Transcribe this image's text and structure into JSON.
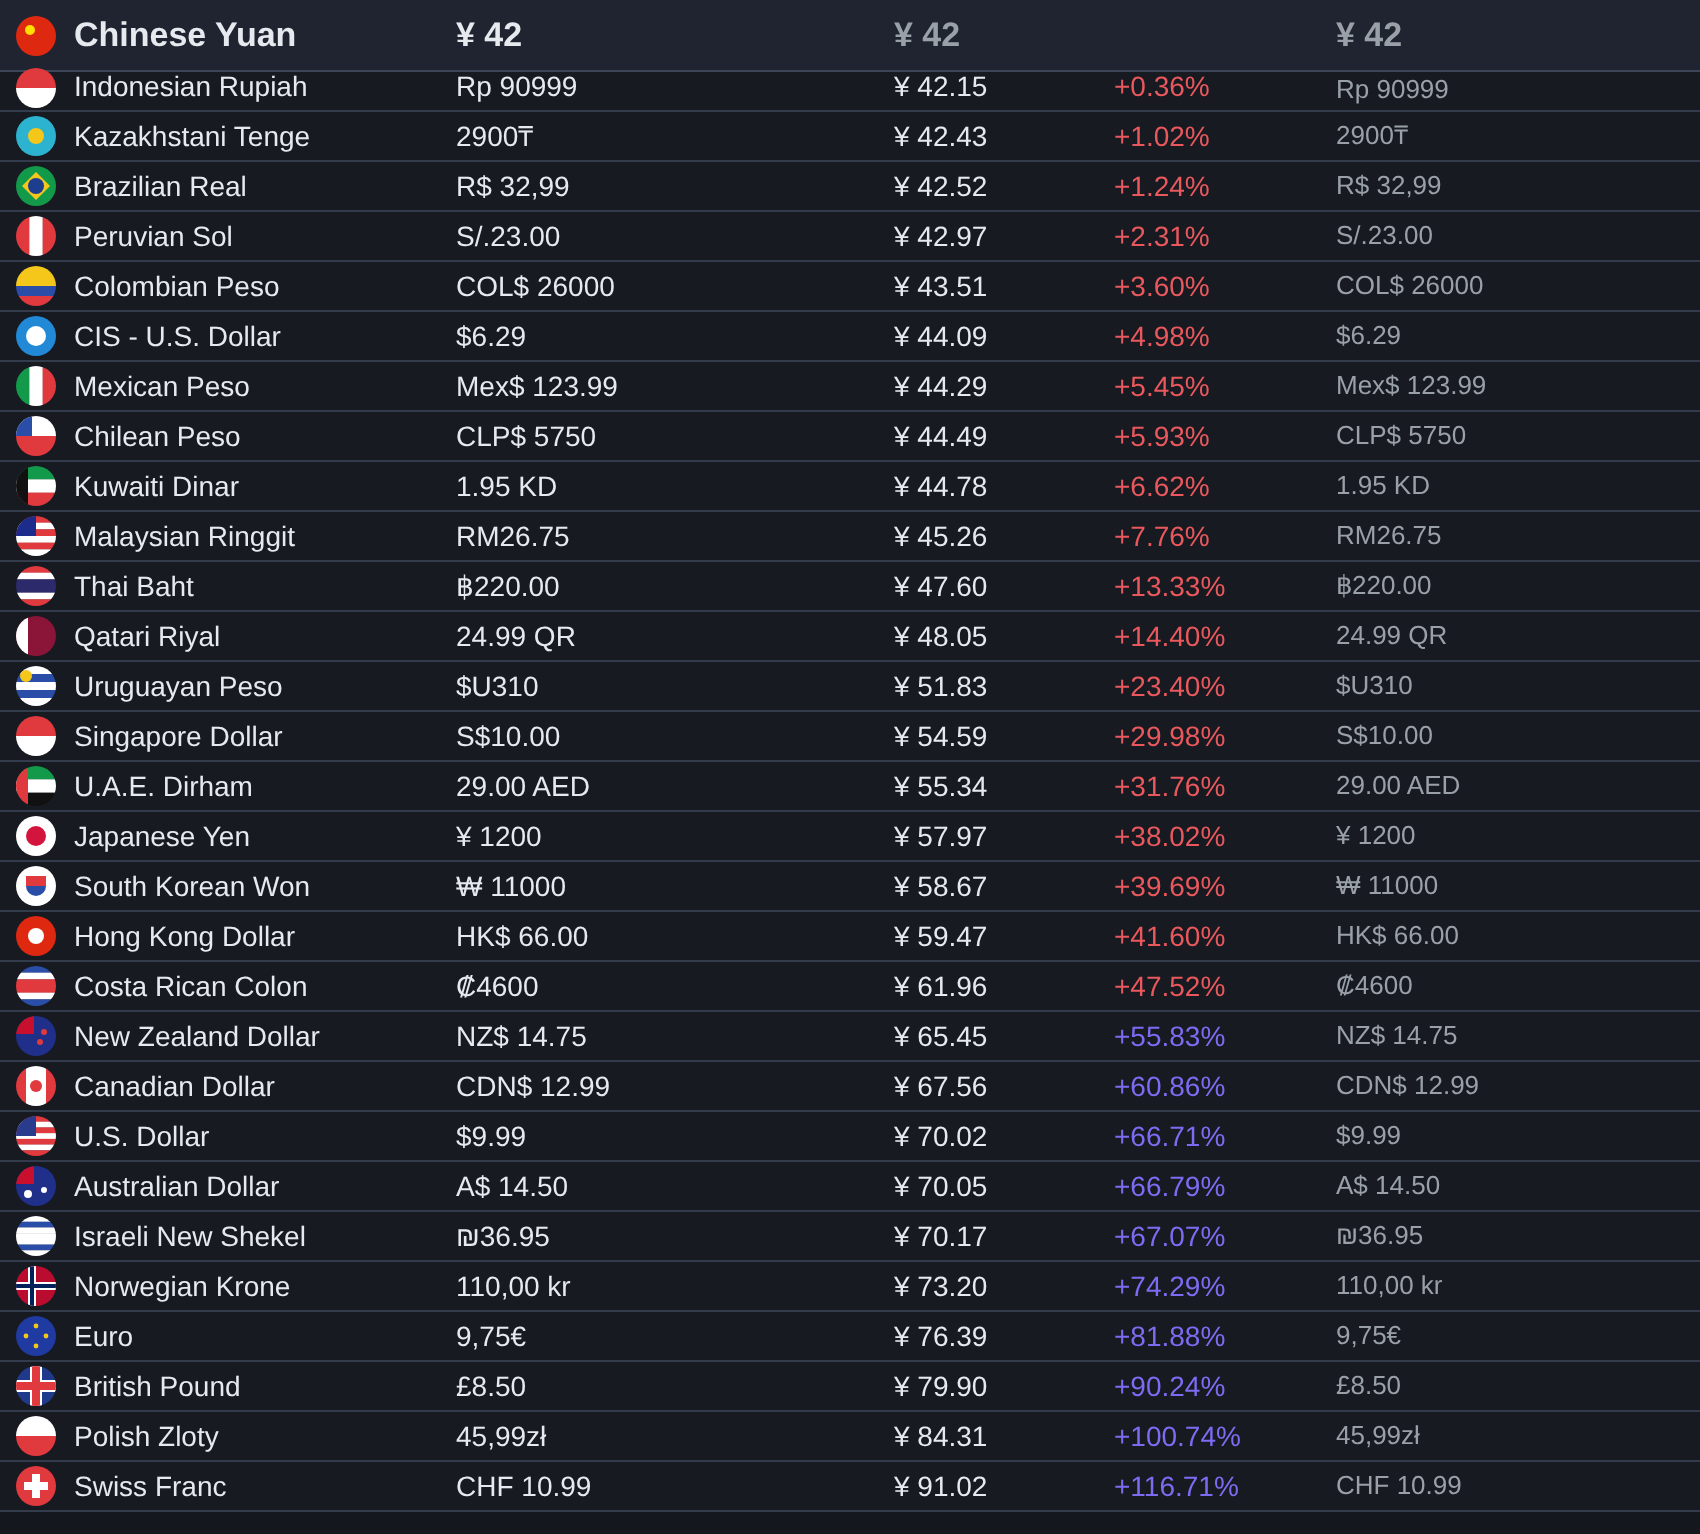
{
  "header": {
    "currency": "Chinese Yuan",
    "price": "¥ 42",
    "converted": "¥ 42",
    "original": "¥ 42"
  },
  "rows": [
    {
      "currency": "Indonesian Rupiah",
      "price": "Rp 90999",
      "converted": "¥ 42.15",
      "difference": "+0.36%",
      "color": "#e8585d",
      "original": "Rp 90999"
    },
    {
      "currency": "Kazakhstani Tenge",
      "price": "2900₸",
      "converted": "¥ 42.43",
      "difference": "+1.02%",
      "color": "#e8585d",
      "original": "2900₸"
    },
    {
      "currency": "Brazilian Real",
      "price": "R$ 32,99",
      "converted": "¥ 42.52",
      "difference": "+1.24%",
      "color": "#e8585d",
      "original": "R$ 32,99"
    },
    {
      "currency": "Peruvian Sol",
      "price": "S/.23.00",
      "converted": "¥ 42.97",
      "difference": "+2.31%",
      "color": "#e8585d",
      "original": "S/.23.00"
    },
    {
      "currency": "Colombian Peso",
      "price": "COL$ 26000",
      "converted": "¥ 43.51",
      "difference": "+3.60%",
      "color": "#e8585d",
      "original": "COL$ 26000"
    },
    {
      "currency": "CIS - U.S. Dollar",
      "price": "$6.29",
      "converted": "¥ 44.09",
      "difference": "+4.98%",
      "color": "#e8585d",
      "original": "$6.29"
    },
    {
      "currency": "Mexican Peso",
      "price": "Mex$ 123.99",
      "converted": "¥ 44.29",
      "difference": "+5.45%",
      "color": "#e8585d",
      "original": "Mex$ 123.99"
    },
    {
      "currency": "Chilean Peso",
      "price": "CLP$ 5750",
      "converted": "¥ 44.49",
      "difference": "+5.93%",
      "color": "#e8585d",
      "original": "CLP$ 5750"
    },
    {
      "currency": "Kuwaiti Dinar",
      "price": "1.95 KD",
      "converted": "¥ 44.78",
      "difference": "+6.62%",
      "color": "#e8585d",
      "original": "1.95 KD"
    },
    {
      "currency": "Malaysian Ringgit",
      "price": "RM26.75",
      "converted": "¥ 45.26",
      "difference": "+7.76%",
      "color": "#e8585d",
      "original": "RM26.75"
    },
    {
      "currency": "Thai Baht",
      "price": "฿220.00",
      "converted": "¥ 47.60",
      "difference": "+13.33%",
      "color": "#e8585d",
      "original": "฿220.00"
    },
    {
      "currency": "Qatari Riyal",
      "price": "24.99 QR",
      "converted": "¥ 48.05",
      "difference": "+14.40%",
      "color": "#e8585d",
      "original": "24.99 QR"
    },
    {
      "currency": "Uruguayan Peso",
      "price": "$U310",
      "converted": "¥ 51.83",
      "difference": "+23.40%",
      "color": "#e8585d",
      "original": "$U310"
    },
    {
      "currency": "Singapore Dollar",
      "price": "S$10.00",
      "converted": "¥ 54.59",
      "difference": "+29.98%",
      "color": "#e8585d",
      "original": "S$10.00"
    },
    {
      "currency": "U.A.E. Dirham",
      "price": "29.00 AED",
      "converted": "¥ 55.34",
      "difference": "+31.76%",
      "color": "#e8585d",
      "original": "29.00 AED"
    },
    {
      "currency": "Japanese Yen",
      "price": "¥ 1200",
      "converted": "¥ 57.97",
      "difference": "+38.02%",
      "color": "#e8585d",
      "original": "¥ 1200"
    },
    {
      "currency": "South Korean Won",
      "price": "₩ 11000",
      "converted": "¥ 58.67",
      "difference": "+39.69%",
      "color": "#e8585d",
      "original": "₩ 11000"
    },
    {
      "currency": "Hong Kong Dollar",
      "price": "HK$ 66.00",
      "converted": "¥ 59.47",
      "difference": "+41.60%",
      "color": "#e8585d",
      "original": "HK$ 66.00"
    },
    {
      "currency": "Costa Rican Colon",
      "price": "₡4600",
      "converted": "¥ 61.96",
      "difference": "+47.52%",
      "color": "#e8585d",
      "original": "₡4600"
    },
    {
      "currency": "New Zealand Dollar",
      "price": "NZ$ 14.75",
      "converted": "¥ 65.45",
      "difference": "+55.83%",
      "color": "#7c6cf2",
      "original": "NZ$ 14.75"
    },
    {
      "currency": "Canadian Dollar",
      "price": "CDN$ 12.99",
      "converted": "¥ 67.56",
      "difference": "+60.86%",
      "color": "#7c6cf2",
      "original": "CDN$ 12.99"
    },
    {
      "currency": "U.S. Dollar",
      "price": "$9.99",
      "converted": "¥ 70.02",
      "difference": "+66.71%",
      "color": "#7c6cf2",
      "original": "$9.99"
    },
    {
      "currency": "Australian Dollar",
      "price": "A$ 14.50",
      "converted": "¥ 70.05",
      "difference": "+66.79%",
      "color": "#7c6cf2",
      "original": "A$ 14.50"
    },
    {
      "currency": "Israeli New Shekel",
      "price": "₪36.95",
      "converted": "¥ 70.17",
      "difference": "+67.07%",
      "color": "#7c6cf2",
      "original": "₪36.95"
    },
    {
      "currency": "Norwegian Krone",
      "price": "110,00 kr",
      "converted": "¥ 73.20",
      "difference": "+74.29%",
      "color": "#7c6cf2",
      "original": "110,00 kr"
    },
    {
      "currency": "Euro",
      "price": "9,75€",
      "converted": "¥ 76.39",
      "difference": "+81.88%",
      "color": "#7c6cf2",
      "original": "9,75€"
    },
    {
      "currency": "British Pound",
      "price": "£8.50",
      "converted": "¥ 79.90",
      "difference": "+90.24%",
      "color": "#7c6cf2",
      "original": "£8.50"
    },
    {
      "currency": "Polish Zloty",
      "price": "45,99zł",
      "converted": "¥ 84.31",
      "difference": "+100.74%",
      "color": "#7c6cf2",
      "original": "45,99zł"
    },
    {
      "currency": "Swiss Franc",
      "price": "CHF 10.99",
      "converted": "¥ 91.02",
      "difference": "+116.71%",
      "color": "#7c6cf2",
      "original": "CHF 10.99"
    }
  ]
}
